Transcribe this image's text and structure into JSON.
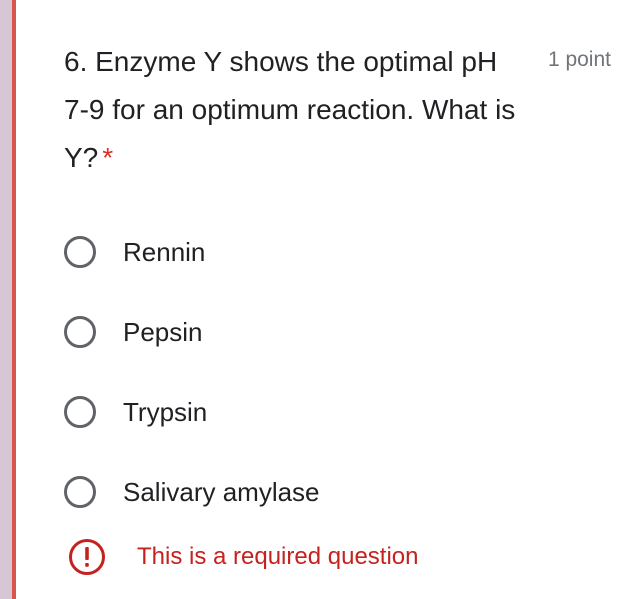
{
  "question": {
    "text": "6. Enzyme Y shows the optimal pH 7-9 for an optimum reaction. What is Y?",
    "required_marker": "*",
    "points": "1 point"
  },
  "options": [
    {
      "label": "Rennin",
      "selected": false
    },
    {
      "label": "Pepsin",
      "selected": false
    },
    {
      "label": "Trypsin",
      "selected": false
    },
    {
      "label": "Salivary amylase",
      "selected": false
    }
  ],
  "error": {
    "icon": "alert-circle-icon",
    "message": "This is a required question"
  },
  "colors": {
    "accent_error": "#d93025",
    "error_text": "#c5221f",
    "side_strip": "#d7c6d6",
    "radio_border": "#5f6368"
  }
}
